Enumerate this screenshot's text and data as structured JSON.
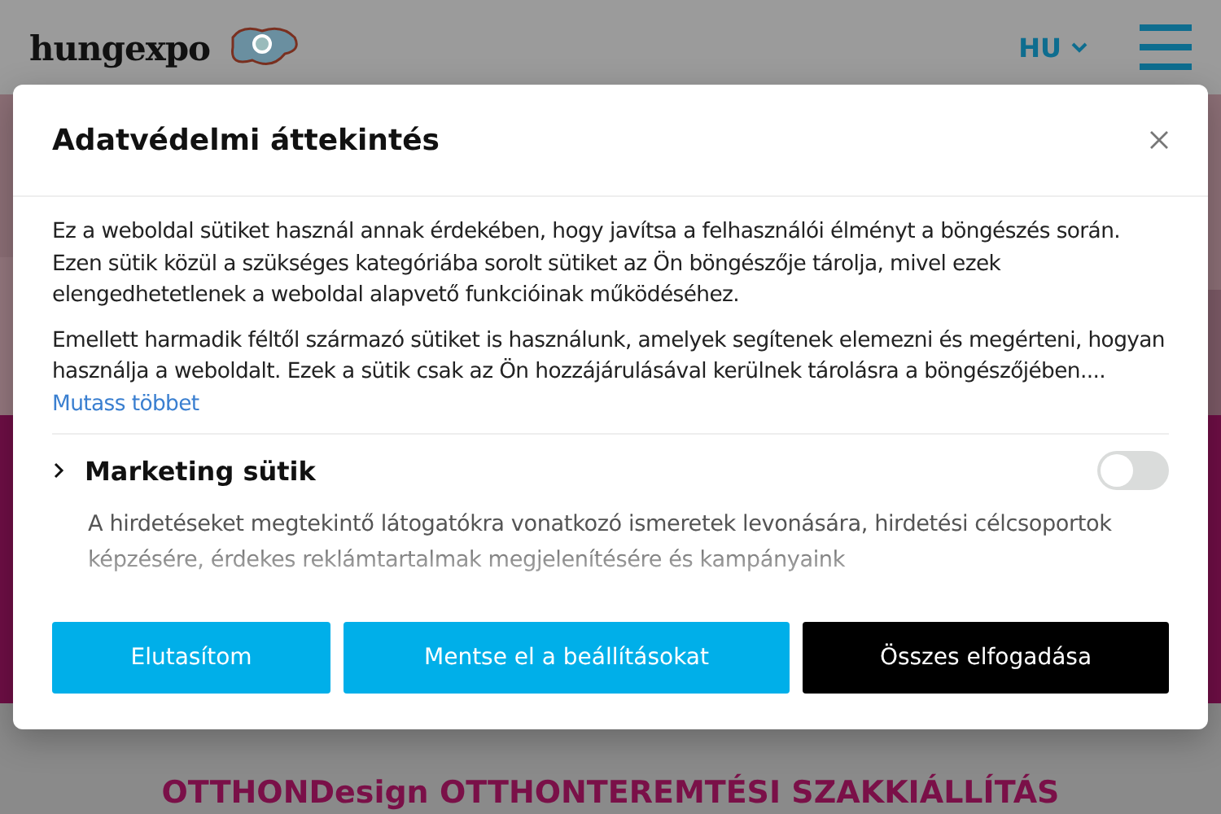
{
  "header": {
    "logo": "hungexpo",
    "language": "HU"
  },
  "page_heading": "OTTHONDesign OTTHONTEREMTÉSI SZAKKIÁLLÍTÁS",
  "dialog": {
    "title": "Adatvédelmi áttekintés",
    "paragraphs": [
      "Ez a weboldal sütiket használ annak érdekében, hogy javítsa a felhasználói élményt a böngészés során. Ezen sütik közül a szükséges kategóriába sorolt sütiket az Ön böngészője tárolja, mivel ezek elengedhetetlenek a weboldal alapvető funkcióinak működéséhez.",
      "Emellett harmadik féltől származó sütiket is használunk, amelyek segítenek elemezni és megérteni, hogyan használja a weboldalt. Ezek a sütik csak az Ön hozzájárulásával kerülnek tárolásra a böngészőjében...."
    ],
    "more_link": "Mutass többet",
    "categories": [
      {
        "name": "Marketing sütik",
        "expanded": false,
        "on": false,
        "description": "A hirdetéseket megtekintő látogatókra vonatkozó ismeretek levonására, hirdetési célcsoportok képzésére, érdekes reklámtartalmak megjelenítésére és kampányaink"
      }
    ],
    "buttons": [
      {
        "label": "Elutasítom",
        "kind": "secondary"
      },
      {
        "label": "Mentse el a beállításokat",
        "kind": "secondary"
      },
      {
        "label": "Összes elfogadása",
        "kind": "primary"
      }
    ]
  }
}
